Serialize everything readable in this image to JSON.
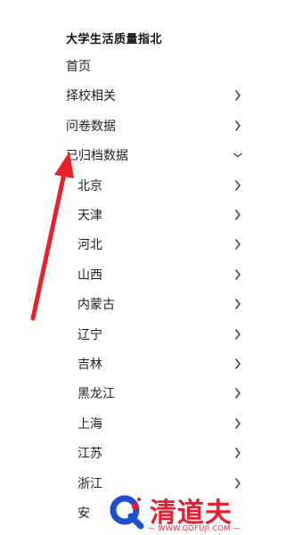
{
  "brand": {
    "title": "大学生活质量指北"
  },
  "nav": {
    "top": [
      {
        "label": "首页",
        "chevron": "none"
      },
      {
        "label": "择校相关",
        "chevron": "right"
      },
      {
        "label": "问卷数据",
        "chevron": "right"
      },
      {
        "label": "已归档数据",
        "chevron": "down"
      }
    ],
    "archived": [
      {
        "label": "北京"
      },
      {
        "label": "天津"
      },
      {
        "label": "河北"
      },
      {
        "label": "山西"
      },
      {
        "label": "内蒙古"
      },
      {
        "label": "辽宁"
      },
      {
        "label": "吉林"
      },
      {
        "label": "黑龙江"
      },
      {
        "label": "上海"
      },
      {
        "label": "江苏"
      },
      {
        "label": "浙江"
      },
      {
        "label": "安"
      }
    ]
  },
  "annotation": {
    "arrow_color": "#e8202a"
  },
  "watermark": {
    "text": "清道夫",
    "subtext": "— WWW.QDFUJI.COM —",
    "color": "#e61e2e"
  }
}
